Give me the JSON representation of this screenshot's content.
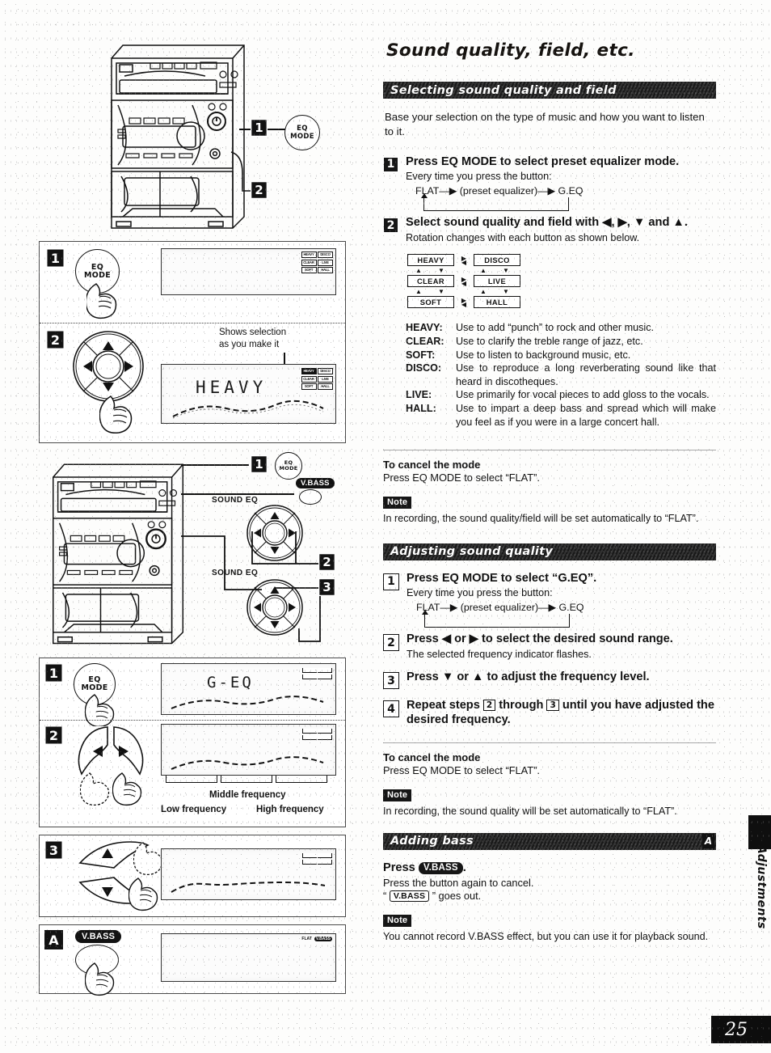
{
  "page": {
    "title": "Sound quality, field, etc.",
    "number": "25",
    "side_tab": "Adjustments"
  },
  "section1": {
    "band": "Selecting sound quality and field",
    "intro": "Base your selection on the type of music and how you want to listen to it.",
    "steps": [
      {
        "num": "1",
        "heading": "Press EQ MODE to select preset equalizer mode.",
        "sub": "Every time you press the button:",
        "flow": "FLAT—▶ (preset equalizer)—▶ G.EQ"
      },
      {
        "num": "2",
        "heading": "Select sound quality and field with ◀, ▶, ▼ and ▲.",
        "sub": "Rotation changes with each button as shown below."
      }
    ],
    "rotation": {
      "left_column": [
        "HEAVY",
        "CLEAR",
        "SOFT"
      ],
      "right_column": [
        "DISCO",
        "LIVE",
        "HALL"
      ],
      "h_arrows": [
        "▶",
        "◀"
      ],
      "v_arrows": [
        "▲",
        "▼"
      ]
    },
    "definitions": [
      {
        "term": "HEAVY:",
        "desc": "Use to add “punch” to rock and other music."
      },
      {
        "term": "CLEAR:",
        "desc": "Use to clarify the treble range of jazz, etc."
      },
      {
        "term": "SOFT:",
        "desc": "Use to listen to background music, etc."
      },
      {
        "term": "DISCO:",
        "desc": "Use to reproduce a long reverberating sound like that heard in discotheques."
      },
      {
        "term": "LIVE:",
        "desc": "Use primarily for vocal pieces to add gloss to the vocals."
      },
      {
        "term": "HALL:",
        "desc": "Use to impart a deep bass and spread which will make you feel as if you were in a large concert hall."
      }
    ],
    "cancel_heading": "To cancel the mode",
    "cancel_text": "Press EQ MODE to select “FLAT”.",
    "note_tag": "Note",
    "note_text": "In recording, the sound quality/field will be set automatically to “FLAT”."
  },
  "section2": {
    "band": "Adjusting sound quality",
    "steps": [
      {
        "num": "1",
        "heading": "Press EQ MODE to select “G.EQ”.",
        "sub": "Every time you press the button:",
        "flow": "FLAT—▶ (preset equalizer)—▶ G.EQ"
      },
      {
        "num": "2",
        "heading": "Press ◀ or ▶ to select the desired sound range.",
        "sub": "The selected frequency indicator flashes."
      },
      {
        "num": "3",
        "heading": "Press ▼ or ▲ to adjust the frequency level.",
        "sub": ""
      },
      {
        "num": "4",
        "heading_pre": "Repeat steps",
        "heading_a": "2",
        "heading_mid": "through",
        "heading_b": "3",
        "heading_post": "until you have adjusted the desired frequency.",
        "sub": ""
      }
    ],
    "cancel_heading": "To cancel the mode",
    "cancel_text": "Press EQ MODE to select “FLAT”.",
    "note_tag": "Note",
    "note_text": "In recording, the sound quality will be set automatically to “FLAT”."
  },
  "section3": {
    "band": "Adding bass",
    "band_tag": "A",
    "press_label": "Press",
    "vbass_key": "V.BASS",
    "press_period": ".",
    "line2": "Press the button again to cancel.",
    "line3_pre": "“",
    "line3_key": "V.BASS",
    "line3_post": "” goes out.",
    "note_tag": "Note",
    "note_text": "You cannot record V.BASS effect, but you can use it for playback sound."
  },
  "figures": {
    "top": {
      "callouts": [
        "1",
        "2"
      ],
      "eq_mode_button": {
        "line1": "EQ",
        "line2": "MODE"
      }
    },
    "panelA": {
      "badges": [
        "1",
        "2"
      ],
      "eq_mode_button": {
        "line1": "EQ",
        "line2": "MODE"
      },
      "shows_selection": "Shows selection\nas you make it",
      "shows_selection_l1": "Shows selection",
      "shows_selection_l2": "as you make it",
      "display_text": "HEAVY",
      "indicators": [
        "HEAVY",
        "DISCO",
        "CLEAR",
        "LIVE",
        "SOFT",
        "HALL"
      ],
      "active_indicator": "HEAVY"
    },
    "panelB": {
      "callouts": [
        "1",
        "2",
        "3"
      ],
      "eq_mode_button": {
        "line1": "EQ",
        "line2": "MODE"
      },
      "vbass_label": "V.BASS",
      "sound_eq_label_1": "SOUND EQ",
      "sound_eq_label_2": "SOUND EQ"
    },
    "panelC": {
      "badges": [
        "1",
        "2",
        "3",
        "A"
      ],
      "eq_mode_button": {
        "line1": "EQ",
        "line2": "MODE"
      },
      "display_text": "G-EQ",
      "freq_labels": {
        "low": "Low frequency",
        "middle": "Middle frequency",
        "high": "High frequency"
      },
      "vbass_label": "V.BASS",
      "flat_indicator": "FLAT",
      "vbass_indicator": "V.BASS"
    }
  }
}
